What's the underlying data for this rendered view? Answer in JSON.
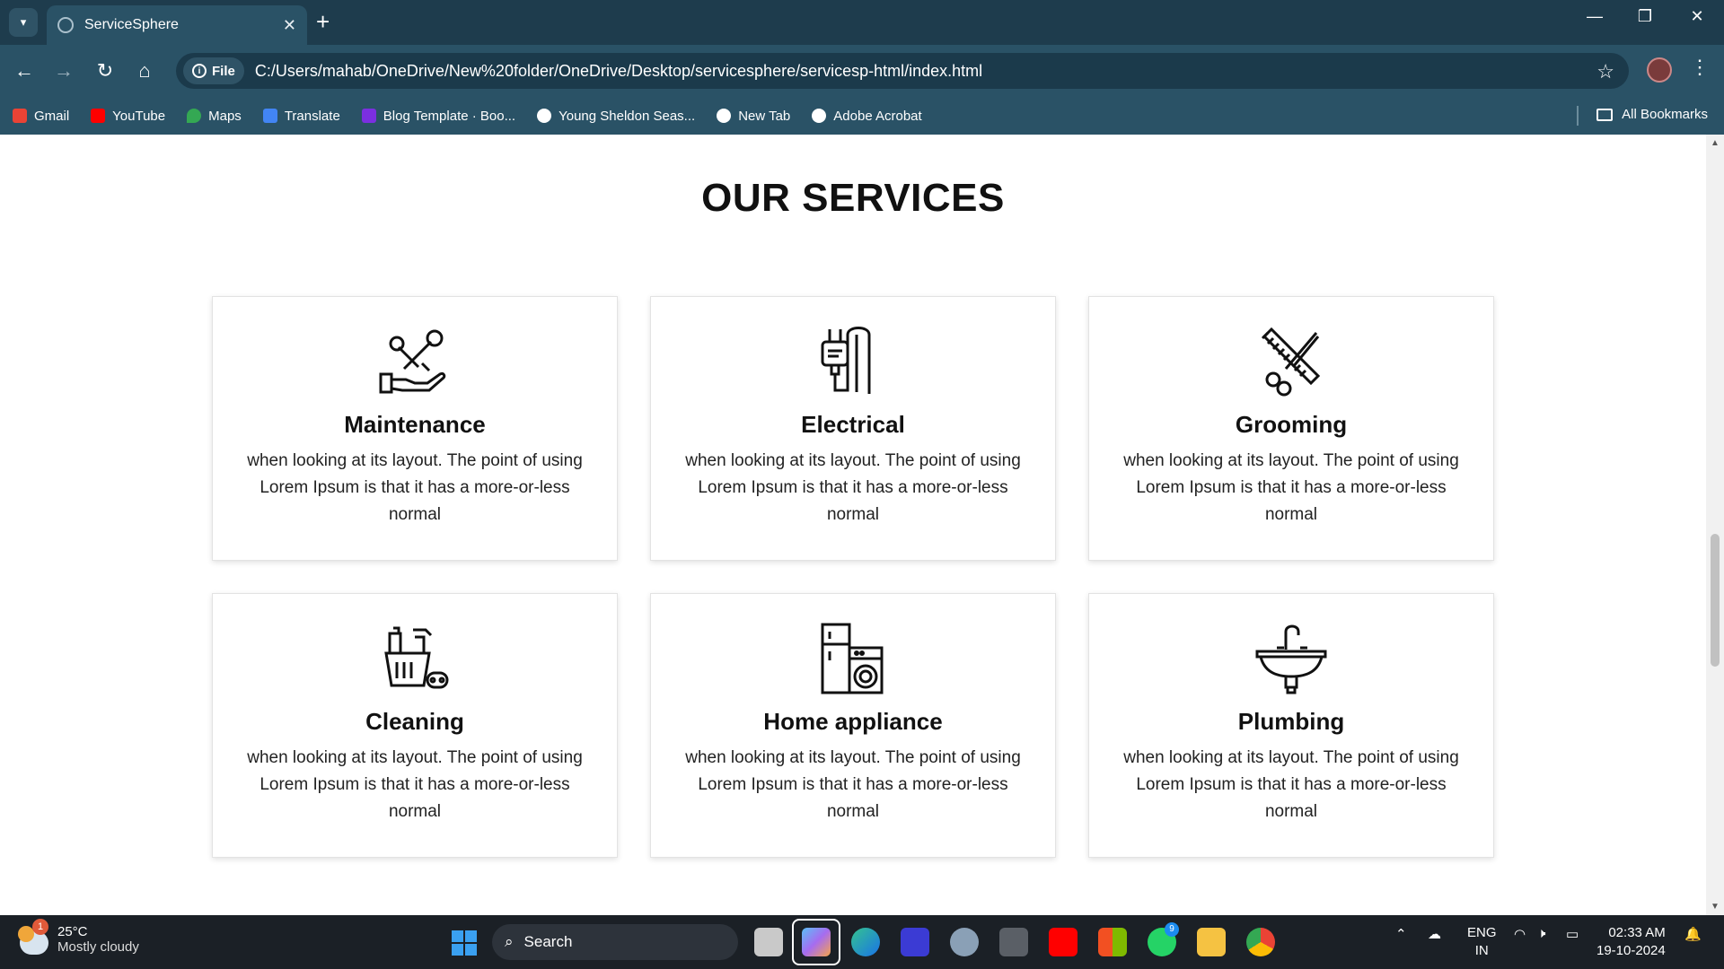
{
  "browser": {
    "tab_title": "ServiceSphere",
    "file_chip": "File",
    "url": "C:/Users/mahab/OneDrive/New%20folder/OneDrive/Desktop/servicesphere/servicesp-html/index.html",
    "bookmarks": [
      {
        "label": "Gmail",
        "color": "#ea4335"
      },
      {
        "label": "YouTube",
        "color": "#ff0000"
      },
      {
        "label": "Maps",
        "color": "#34a853"
      },
      {
        "label": "Translate",
        "color": "#4285f4"
      },
      {
        "label": "Blog Template · Boo...",
        "color": "#7b2fe0"
      },
      {
        "label": "Young Sheldon Seas...",
        "color": "#ffffff"
      },
      {
        "label": "New Tab",
        "color": "#ffffff"
      },
      {
        "label": "Adobe Acrobat",
        "color": "#ffffff"
      }
    ],
    "all_bookmarks": "All Bookmarks"
  },
  "page": {
    "section_title": "OUR SERVICES",
    "services": [
      {
        "title": "Maintenance",
        "icon": "wrench-hand-icon",
        "text": "when looking at its layout. The point of using Lorem Ipsum is that it has a more-or-less normal"
      },
      {
        "title": "Electrical",
        "icon": "plug-icon",
        "text": "when looking at its layout. The point of using Lorem Ipsum is that it has a more-or-less normal"
      },
      {
        "title": "Grooming",
        "icon": "scissors-comb-icon",
        "text": "when looking at its layout. The point of using Lorem Ipsum is that it has a more-or-less normal"
      },
      {
        "title": "Cleaning",
        "icon": "cleaning-bucket-icon",
        "text": "when looking at its layout. The point of using Lorem Ipsum is that it has a more-or-less normal"
      },
      {
        "title": "Home appliance",
        "icon": "fridge-washer-icon",
        "text": "when looking at its layout. The point of using Lorem Ipsum is that it has a more-or-less normal"
      },
      {
        "title": "Plumbing",
        "icon": "sink-icon",
        "text": "when looking at its layout. The point of using Lorem Ipsum is that it has a more-or-less normal"
      }
    ]
  },
  "taskbar": {
    "weather_badge": "1",
    "temperature": "25°C",
    "condition": "Mostly cloudy",
    "search_label": "Search",
    "whatsapp_badge": "9",
    "lang_line1": "ENG",
    "lang_line2": "IN",
    "time": "02:33 AM",
    "date": "19-10-2024"
  }
}
